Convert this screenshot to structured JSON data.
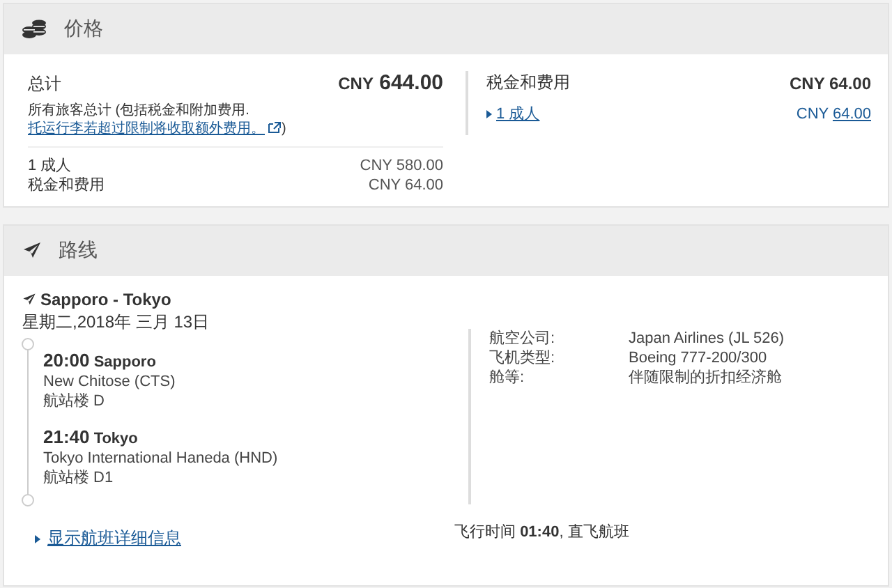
{
  "price": {
    "title": "价格",
    "total": {
      "label": "总计",
      "currency": "CNY",
      "amount": "644.00"
    },
    "note": {
      "text": "所有旅客总计 (包括税金和附加费用. ",
      "link": "托运行李若超过限制将收取额外费用。",
      "close": ")"
    },
    "lines": [
      {
        "label": "1 成人",
        "value": "CNY 580.00"
      },
      {
        "label": "税金和费用",
        "value": "CNY 64.00"
      }
    ],
    "taxes": {
      "label": "税金和费用",
      "value": "CNY 64.00",
      "item": {
        "label": "1 成人",
        "currency": "CNY",
        "amount": "64.00",
        "expanded": false
      }
    }
  },
  "route": {
    "title": "路线",
    "heading": "Sapporo - Tokyo",
    "date": "星期二,2018年 三月 13日",
    "stops": [
      {
        "time": "20:00",
        "city": "Sapporo",
        "airport": "New Chitose (CTS)",
        "terminal": "航站楼 D"
      },
      {
        "time": "21:40",
        "city": "Tokyo",
        "airport": "Tokyo International Haneda (HND)",
        "terminal": "航站楼 D1"
      }
    ],
    "details": [
      {
        "label": "航空公司:",
        "value": "Japan Airlines (JL 526)"
      },
      {
        "label": "飞机类型:",
        "value": "Boeing 777-200/300"
      },
      {
        "label": "舱等:",
        "value": "伴随限制的折扣经济舱"
      }
    ],
    "more_link": {
      "label": "显示航班详细信息",
      "expanded": false
    },
    "duration": "飞行时间 **01:40**, 直飞航班"
  }
}
